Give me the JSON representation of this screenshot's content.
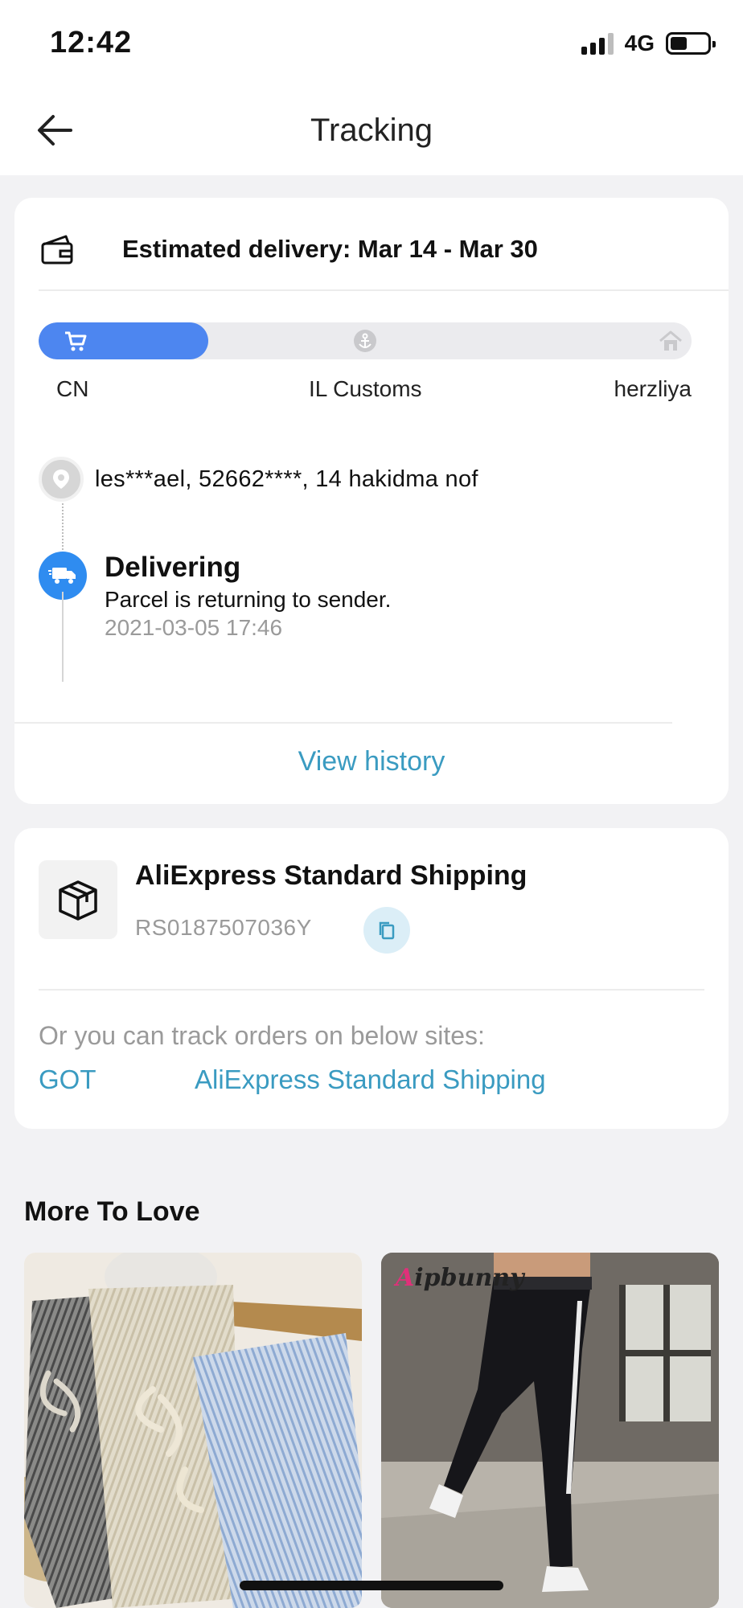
{
  "status_bar": {
    "time": "12:42",
    "network": "4G"
  },
  "header": {
    "title": "Tracking"
  },
  "tracking": {
    "estimated_delivery": "Estimated delivery: Mar 14 - Mar 30",
    "progress_fraction": 0.26,
    "stages": [
      "CN",
      "IL Customs",
      "herzliya"
    ],
    "address": "les***ael,  52662****,  14 hakidma nof",
    "latest_event": {
      "title": "Delivering",
      "description": "Parcel is returning to sender.",
      "time": "2021-03-05 17:46"
    },
    "view_history_label": "View history"
  },
  "shipping": {
    "carrier": "AliExpress Standard Shipping",
    "tracking_number": "RS0187507036Y",
    "other_sites_label": "Or you can track orders on below sites:",
    "sites": [
      "GOT",
      "AliExpress Standard Shipping"
    ]
  },
  "recommendations": {
    "title": "More To Love",
    "product_2_brand": "Aipbunny"
  },
  "colors": {
    "accent_blue": "#4d86f0",
    "link_blue": "#3a9bc1",
    "truck_blue": "#2f8cf0"
  }
}
